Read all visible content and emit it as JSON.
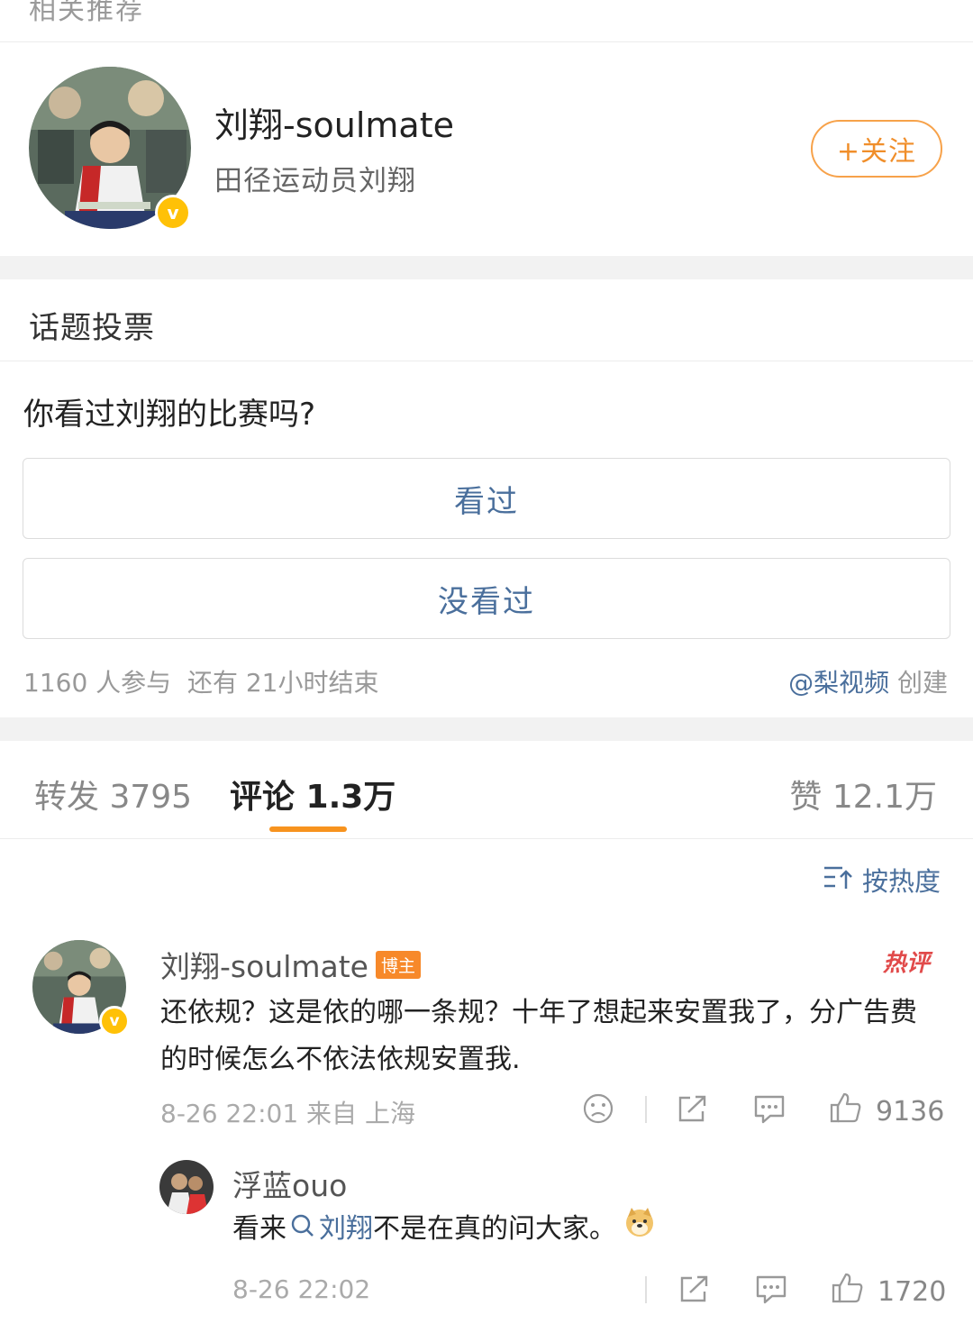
{
  "top_header": {
    "label": "相关推荐"
  },
  "recommend": {
    "name": "刘翔-soulmate",
    "desc": "田径运动员刘翔",
    "follow_label": "+关注"
  },
  "vote": {
    "header": "话题投票",
    "question": "你看过刘翔的比赛吗?",
    "options": [
      "看过",
      "没看过"
    ],
    "meta": "1160 人参与  还有 21小时结束",
    "creator_mention": "@梨视频",
    "creator_suffix": " 创建"
  },
  "tabs": {
    "repost": "转发 3795",
    "comment": "评论 1.3万",
    "like": "赞 12.1万"
  },
  "sort_label": "按热度",
  "comments": [
    {
      "name": "刘翔-soulmate",
      "badge": "博主",
      "hot_label": "热评",
      "text": "还依规？这是依的哪一条规？十年了想起来安置我了，分广告费的时候怎么不依法依规安置我.",
      "meta": "8-26 22:01 来自 上海",
      "likes": "9136"
    },
    {
      "name": "浮蓝ouo",
      "text_before": "看来",
      "text_link": "刘翔",
      "text_after": "不是在真的问大家。",
      "meta": "8-26 22:02",
      "likes": "1720"
    }
  ],
  "colors": {
    "accent": "#f7931e",
    "link": "#4a6f9c",
    "band": "#f2f2f2"
  }
}
